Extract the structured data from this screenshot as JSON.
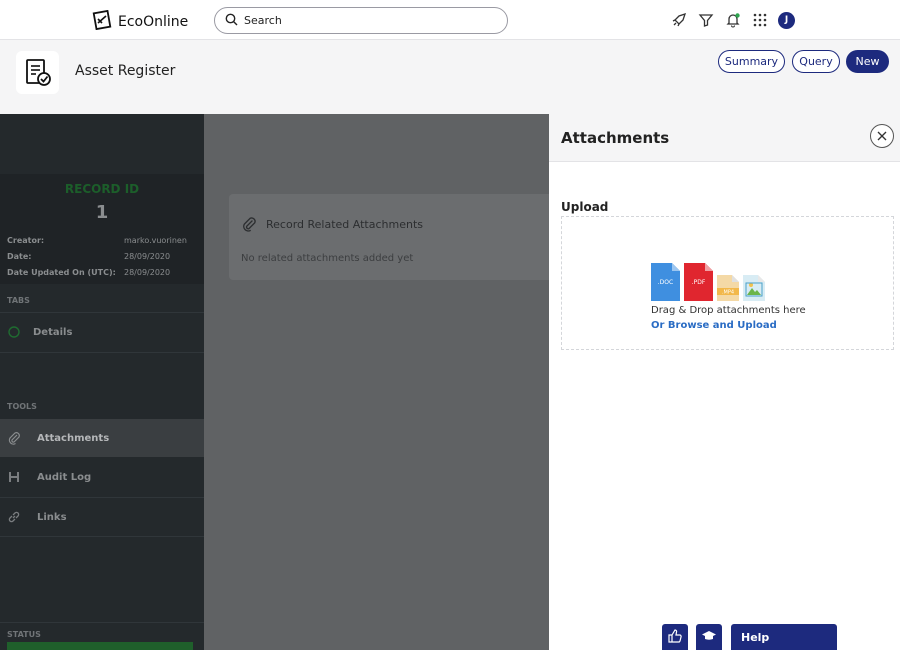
{
  "brand": {
    "name": "EcoOnline"
  },
  "search": {
    "placeholder": "Search"
  },
  "user": {
    "initial": "J"
  },
  "header": {
    "title": "Asset Register",
    "buttons": {
      "summary": "Summary",
      "query": "Query",
      "new": "New"
    }
  },
  "record": {
    "label": "RECORD ID",
    "id": "1",
    "meta": [
      {
        "label": "Creator:",
        "value": "marko.vuorinen"
      },
      {
        "label": "Date:",
        "value": "28/09/2020"
      },
      {
        "label": "Date Updated On (UTC):",
        "value": "28/09/2020"
      }
    ]
  },
  "sidebar": {
    "tabs_label": "TABS",
    "tabs": [
      {
        "label": "Details"
      }
    ],
    "tools_label": "TOOLS",
    "tools": [
      {
        "label": "Attachments"
      },
      {
        "label": "Audit Log"
      },
      {
        "label": "Links"
      }
    ],
    "status_label": "STATUS"
  },
  "related": {
    "title": "Record Related Attachments",
    "empty": "No related attachments added yet"
  },
  "drawer": {
    "title": "Attachments",
    "upload_title": "Upload",
    "drop_text": "Drag & Drop attachments here",
    "browse_text": "Or Browse and Upload",
    "file_types": [
      ".DOC",
      ".PDF",
      ".MP4",
      ""
    ]
  },
  "footer": {
    "help": "Help"
  },
  "colors": {
    "accent": "#1d2a7e",
    "link": "#2a6cc4",
    "success": "#1f5f2b"
  }
}
